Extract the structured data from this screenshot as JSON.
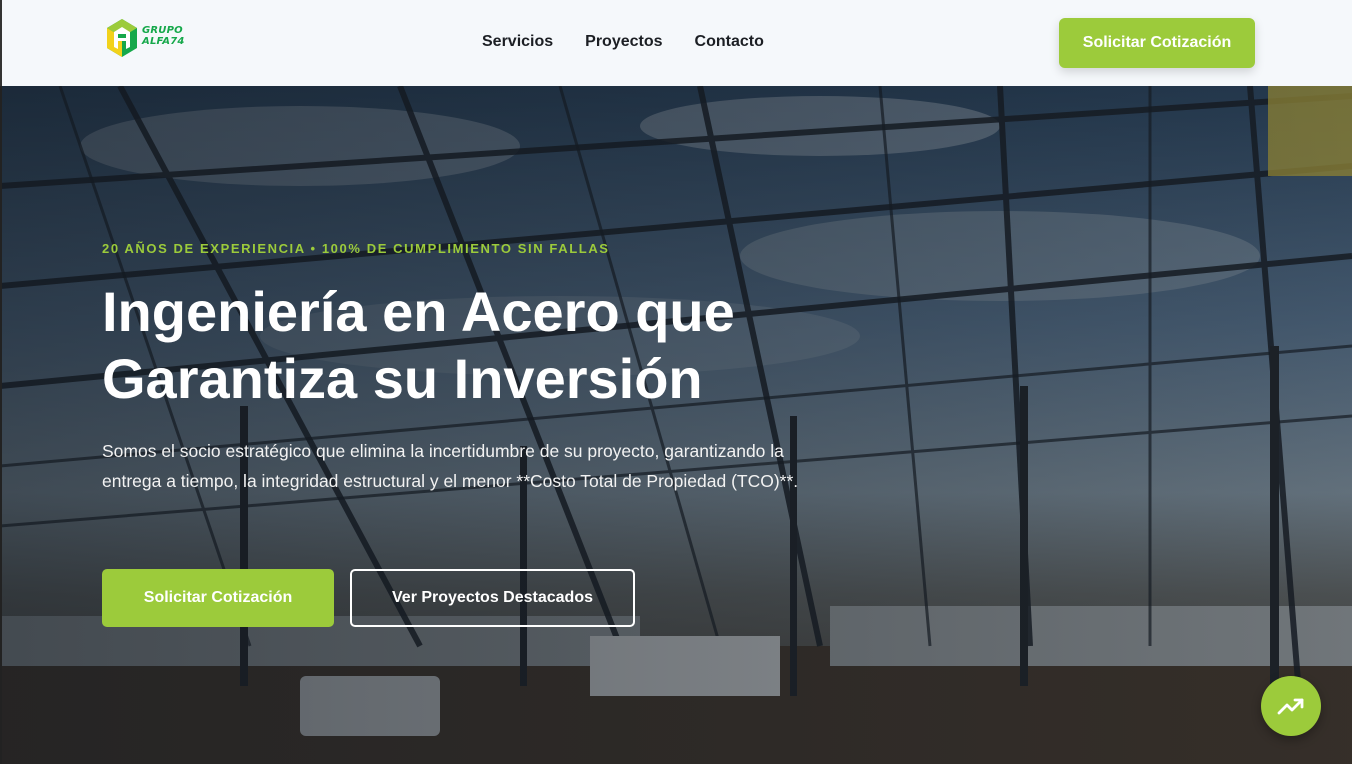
{
  "header": {
    "logo": {
      "line1": "GRUPO",
      "line2": "ALFA74",
      "colors": {
        "green": "#15a84a",
        "yellow": "#f2d21b",
        "lime": "#9ccb3b"
      }
    },
    "nav": [
      {
        "label": "Servicios"
      },
      {
        "label": "Proyectos"
      },
      {
        "label": "Contacto"
      }
    ],
    "cta_label": "Solicitar Cotización"
  },
  "hero": {
    "eyebrow": "20 AÑOS DE EXPERIENCIA • 100% DE CUMPLIMIENTO SIN FALLAS",
    "title": "Ingeniería en Acero que Garantiza su Inversión",
    "subtitle": "Somos el socio estratégico que elimina la incertidumbre de su proyecto, garantizando la entrega a tiempo, la integridad estructural y el menor **Costo Total de Propiedad (TCO)**.",
    "primary_button": "Solicitar Cotización",
    "secondary_button": "Ver Proyectos Destacados",
    "background_image": "steel-structure-construction-site"
  },
  "floating_button": {
    "icon": "trending-up-icon"
  },
  "colors": {
    "accent": "#9ccb3b",
    "header_bg": "#f5f8fb",
    "text_dark": "#1c1f24"
  }
}
